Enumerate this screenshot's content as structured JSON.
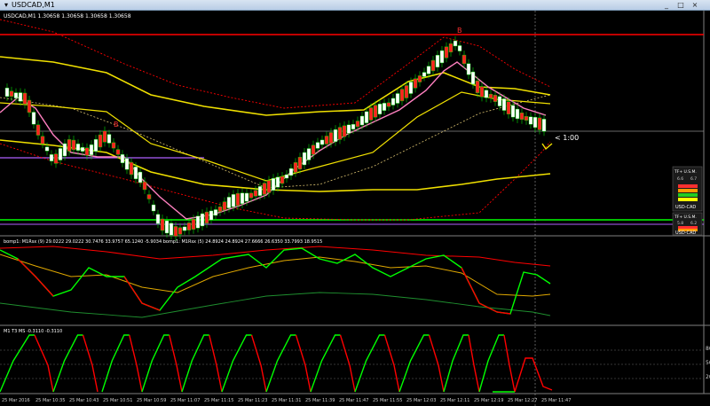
{
  "window": {
    "icon": "chart-icon",
    "title": "USDCAD,M1",
    "buttons": {
      "minimize": "_",
      "maximize": "□",
      "close": "×"
    }
  },
  "main_panel": {
    "ohlc_text": "USDCAD,M1  1.30658 1.30658 1.30658 1.30658",
    "countdown": "< 1:00",
    "marker": "B",
    "widgets": [
      {
        "header": "TF+ U.S.M.",
        "v1": "6.6",
        "v2": "6.7",
        "symbol": "USD-CAD"
      },
      {
        "header": "TF+ U.S.M.",
        "v1": "5.8",
        "v2": "6.2",
        "symbol": "USD-CAD"
      }
    ]
  },
  "indicator_panel_1": {
    "label": "bomp1: M1Rsx (9) 29.0222 29.0222 30.7476 33.9757 65.1240 -5.9034  bomp1: M1Rsx (5) 24.8924 24.8924 27.6666 26.6350 33.7993 18.9515"
  },
  "indicator_panel_2": {
    "label": "M1  T3 MS  -0.3110 -0.3110",
    "levels": [
      "80",
      "50",
      "20"
    ]
  },
  "time_axis": {
    "labels": [
      "25 Mar 2016",
      "25 Mar 10:35",
      "25 Mar 10:43",
      "25 Mar 10:51",
      "25 Mar 10:59",
      "25 Mar 11:07",
      "25 Mar 11:15",
      "25 Mar 11:23",
      "25 Mar 11:31",
      "25 Mar 11:39",
      "25 Mar 11:47",
      "25 Mar 11:55",
      "25 Mar 12:03",
      "25 Mar 12:11",
      "25 Mar 12:19",
      "25 Mar 12:27",
      "25 Mar 11:47"
    ]
  },
  "colors": {
    "background": "#000000",
    "bull_candle": "#ffffff",
    "bear_candle": "#ff2020",
    "yellow_band": "#f0e000",
    "pink_ma": "#ff80c0",
    "green_line": "#00ff00",
    "red_line": "#ff0000",
    "violet_line": "#b060ff"
  }
}
